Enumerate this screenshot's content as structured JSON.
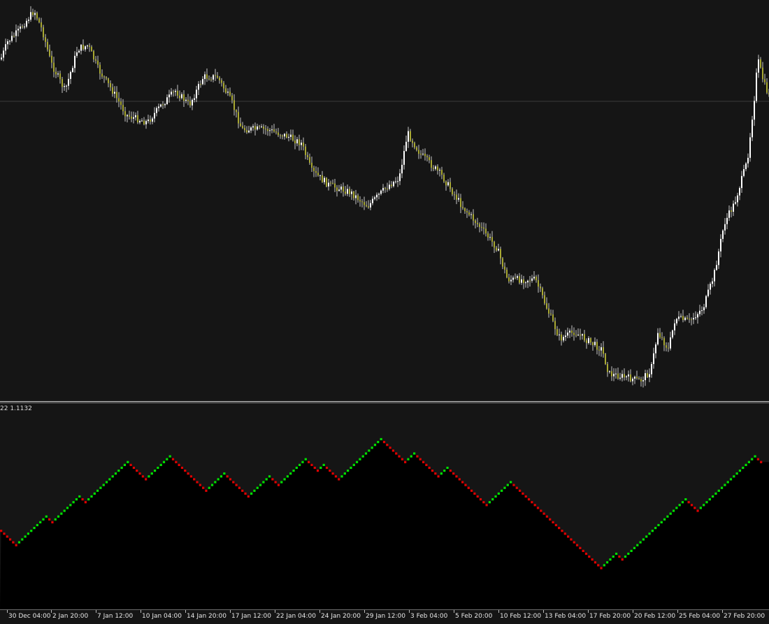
{
  "window": {
    "background": "#151515",
    "panel_fill": "#000000"
  },
  "indicator": {
    "label": "22 1.1132"
  },
  "colors": {
    "bull_candle": "#ffffff",
    "bear_candle": "#a8a832",
    "wick": "#c8c8c8",
    "renko_up": "#00e000",
    "renko_down": "#e00000",
    "gridline": "#3a3a3a"
  },
  "chart_data": [
    {
      "type": "candlestick",
      "title": "",
      "xlabel": "",
      "ylabel": "",
      "y_axis_shown": false,
      "grid": false,
      "horizontal_line": "level near the upper third of the price range",
      "close_path": [
        0.0,
        6.0,
        16.0,
        20.0,
        19.0,
        20.0,
        14.0,
        8.0,
        12.0,
        15.0,
        9.0,
        8.0,
        4.0,
        3.0,
        4.0,
        2.0,
        3.5,
        7.0,
        10.0,
        12.0,
        7.0,
        5.0,
        7.5,
        3.0,
        2.0,
        -2.0,
        -4.0,
        -3.0,
        -3.0,
        -7.0,
        -7.5,
        -7.0,
        -8.5,
        -10.0,
        -6.0,
        -3.5,
        -2.0,
        -3.0,
        0.0,
        1.0,
        3.0,
        5.0,
        6.0,
        9.0,
        12.0,
        14.0,
        16.0,
        17.0,
        15.0,
        12.0,
        8.0,
        4.0,
        0.0,
        -4.0,
        -8.0,
        -10.0,
        -12.0,
        -14.0,
        -13.0,
        -15.0,
        -17.0,
        -16.5,
        -18.0,
        -19.0,
        -21.0,
        -26.0,
        -30.0,
        -35.0,
        -42.0,
        -47.0,
        -50.0,
        -52.0,
        -51.0,
        -53.0,
        -54.0,
        -56.0,
        -58.0,
        -60.0,
        -60.5,
        -60.0,
        -61.0,
        -62.0,
        -63.0,
        -65.0,
        -68.0,
        -72.0,
        -76.0,
        -80.0,
        -84.0,
        -86.0,
        -88.0,
        -89.0,
        -90.0,
        -90.0,
        -91.0,
        -92.0,
        -93.0,
        -94.0,
        -95.0,
        -95.5,
        -96.0,
        -97.0,
        -98.0,
        -98.0,
        -99.0,
        -100.0,
        -101.0,
        -102.0,
        -103.0,
        -104.0,
        -103.5,
        -105.0,
        -106.0,
        -107.0,
        -108.0,
        -109.0,
        -110.0,
        -111.0,
        -112.0,
        -113.0,
        -114.0,
        -115.0,
        -116.0,
        -117.0,
        -118.0,
        -119.0,
        -120.0,
        -120.0,
        -119.0,
        -118.0,
        -117.0,
        -115.0,
        -113.0,
        -111.0,
        -110.0,
        -108.0,
        -106.0,
        -104.0,
        -100.0,
        -95.0,
        -88.0,
        -82.0,
        -78.0,
        -73.0,
        -70.0,
        -66.0,
        -62.0,
        -58.0,
        -55.0,
        -52.0,
        -50.0,
        -49.0,
        -48.0,
        -47.0,
        -46.0,
        -44.0,
        -45.0,
        -47.0,
        -50.0,
        -55.0,
        -60.0,
        -66.0,
        -72.0,
        -80.0,
        -86.0,
        -92.0,
        -95.0,
        -96.0,
        -97.0,
        -98.0,
        -99.0,
        -100.0,
        -101.0,
        -102.0,
        -103.0,
        -104.0,
        -106.0,
        -108.0,
        -112.0,
        -116.0,
        -120.0,
        -125.0,
        -130.0,
        -136.0,
        -140.0,
        -144.0,
        -146.0,
        -148.0,
        -150.0,
        -152.0,
        -154.0,
        -155.0,
        -156.0,
        -157.0,
        -156.0,
        -155.0,
        -157.0,
        -158.0,
        -159.0,
        -162.0,
        -166.0,
        -170.0,
        -174.0,
        -178.0,
        -182.0,
        -186.0,
        -190.0,
        -192.0,
        -194.0,
        -196.0,
        -198.0,
        -200.0,
        -202.0,
        -204.0,
        -206.0,
        -208.0,
        -210.0,
        -212.0,
        -214.0,
        -216.0,
        -218.0,
        -220.0,
        -222.0,
        -224.0,
        -226.0,
        -227.0,
        -228.0,
        -229.0,
        -230.0,
        -231.0,
        -232.0,
        -233.0,
        -234.0,
        -235.0,
        -236.0,
        -237.0,
        -238.0,
        -239.0,
        -240.0,
        -241.0,
        -242.0,
        -243.0,
        -244.0,
        -245.0,
        -246.0,
        -247.0,
        -248.0,
        -249.0,
        -250.0,
        -251.0,
        -252.0,
        -253.0,
        -254.0,
        -255.0,
        -256.0,
        -257.0,
        -258.0,
        -259.0,
        -260.0,
        -260.0,
        -259.0,
        -257.0,
        -255.0,
        -252.0,
        -248.0,
        -244.0,
        -240.0,
        -236.0,
        -232.0,
        -228.0,
        -224.0,
        -220.0,
        -216.0,
        -212.0,
        -208.0,
        -204.0,
        -200.0,
        -196.0,
        -190.0,
        -184.0,
        -178.0,
        -172.0,
        -166.0,
        -160.0,
        -150.0,
        -140.0,
        -130.0,
        -120.0,
        -110.0,
        -100.0,
        -90.0,
        -80.0,
        -70.0,
        -60.0,
        -50.0,
        -40.0,
        -30.0,
        -20.0,
        -10.0,
        0.0,
        10.0,
        20.0,
        30.0,
        40.0,
        50.0,
        60.0,
        70.0,
        80.0,
        90.0,
        100.0,
        110.0,
        120.0,
        130.0,
        140.0,
        150.0,
        160.0,
        170.0,
        180.0,
        190.0,
        200.0,
        210.0,
        220.0,
        230.0,
        240.0,
        250.0,
        260.0,
        270.0,
        280.0,
        290.0,
        300.0,
        310.0,
        320.0,
        330.0,
        340.0,
        350.0
      ],
      "y_range": [
        -265,
        360
      ]
    },
    {
      "type": "line",
      "subtype": "renko-bricks",
      "title": "",
      "label": "22 1.1132",
      "grid": false,
      "steps": [
        -1,
        -1,
        -1,
        -1,
        -1,
        -1,
        1,
        1,
        1,
        1,
        1,
        1,
        1,
        1,
        1,
        1,
        -1,
        -1,
        1,
        1,
        1,
        1,
        1,
        1,
        1,
        1,
        1,
        -1,
        -1,
        1,
        1,
        1,
        1,
        1,
        1,
        1,
        1,
        1,
        1,
        1,
        1,
        1,
        1,
        -1,
        -1,
        -1,
        -1,
        -1,
        -1,
        1,
        1,
        1,
        1,
        1,
        1,
        1,
        1,
        -1,
        -1,
        -1,
        -1,
        -1,
        -1,
        -1,
        -1,
        -1,
        -1,
        -1,
        -1,
        1,
        1,
        1,
        1,
        1,
        1,
        -1,
        -1,
        -1,
        -1,
        -1,
        -1,
        -1,
        -1,
        1,
        1,
        1,
        1,
        1,
        1,
        1,
        -1,
        -1,
        -1,
        1,
        1,
        1,
        1,
        1,
        1,
        1,
        1,
        1,
        -1,
        -1,
        -1,
        -1,
        1,
        1,
        -1,
        -1,
        -1,
        -1,
        -1,
        1,
        1,
        1,
        1,
        1,
        1,
        1,
        1,
        1,
        1,
        1,
        1,
        1,
        1,
        -1,
        -1,
        -1,
        -1,
        -1,
        -1,
        -1,
        -1,
        1,
        1,
        1,
        -1,
        -1,
        -1,
        -1,
        -1,
        -1,
        -1,
        -1,
        1,
        1,
        1,
        -1,
        -1,
        -1,
        -1,
        -1,
        -1,
        -1,
        -1,
        -1,
        -1,
        -1,
        -1,
        -1,
        1,
        1,
        1,
        1,
        1,
        1,
        1,
        1,
        -1,
        -1,
        -1,
        -1,
        -1,
        -1,
        -1,
        -1,
        -1,
        -1,
        -1,
        -1,
        -1,
        -1,
        -1,
        -1,
        -1,
        -1,
        -1,
        -1,
        -1,
        -1,
        -1,
        -1,
        -1,
        -1,
        -1,
        -1,
        -1,
        -1,
        1,
        1,
        1,
        1,
        1,
        -1,
        -1,
        1,
        1,
        1,
        1,
        1,
        1,
        1,
        1,
        1,
        1,
        1,
        1,
        1,
        1,
        1,
        1,
        1,
        1,
        1,
        1,
        1,
        -1,
        -1,
        -1,
        -1,
        1,
        1,
        1,
        1,
        1,
        1,
        1,
        1,
        1,
        1,
        1,
        1,
        1,
        1,
        1,
        1,
        1,
        1,
        1,
        -1,
        -1
      ]
    }
  ],
  "time_axis": {
    "labels": [
      "30 Dec 04:00",
      "2 Jan 20:00",
      "7 Jan 12:00",
      "10 Jan 04:00",
      "14 Jan 20:00",
      "17 Jan 12:00",
      "22 Jan 04:00",
      "24 Jan 20:00",
      "29 Jan 12:00",
      "3 Feb 04:00",
      "5 Feb 20:00",
      "10 Feb 12:00",
      "13 Feb 04:00",
      "17 Feb 20:00",
      "20 Feb 12:00",
      "25 Feb 04:00",
      "27 Feb 20:00"
    ]
  }
}
